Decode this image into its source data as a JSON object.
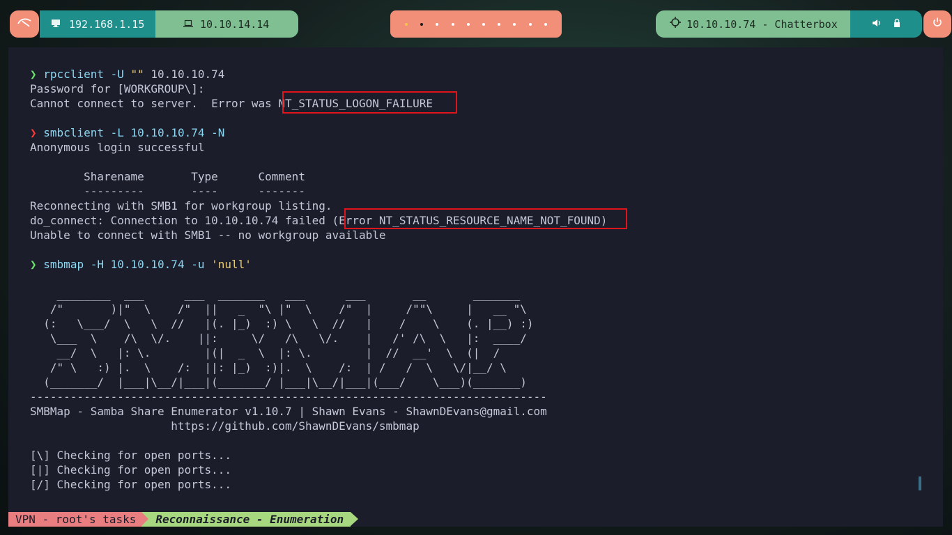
{
  "topbar": {
    "local_ip": "192.168.1.15",
    "vpn_ip": "10.10.14.14",
    "target": "10.10.10.74 - Chatterbox",
    "workspace_count": 10,
    "icons": {
      "logo": "kali-dragon-icon",
      "local": "monitor-icon",
      "vpn": "laptop-icon",
      "target": "crosshair-icon",
      "volume": "volume-icon",
      "lock": "lock-icon",
      "power": "power-icon"
    },
    "colors": {
      "coral": "#f28f79",
      "teal": "#1f8f8c",
      "green": "#7fbf92"
    }
  },
  "terminal": {
    "lines": {
      "l1_cmd": "rpcclient",
      "l1_args": " -U ",
      "l1_str": "\"\"",
      "l1_rest": " 10.10.10.74",
      "l2": "Password for [WORKGROUP\\]:",
      "l3a": "Cannot connect to server.  Error was ",
      "l3b": "NT_STATUS_LOGON_FAILURE",
      "l5_cmd": "smbclient",
      "l5_rest": " -L 10.10.10.74 -N",
      "l6": "Anonymous login successful",
      "l8": "        Sharename       Type      Comment",
      "l9": "        ---------       ----      -------",
      "l10": "Reconnecting with SMB1 for workgroup listing.",
      "l11a": "do_connect: Connection to 10.10.10.74 failed ",
      "l11b": "(Error NT_STATUS_RESOURCE_NAME_NOT_FOUND)",
      "l12": "Unable to connect with SMB1 -- no workgroup available",
      "l14_cmd": "smbmap",
      "l14_args": " -H 10.10.10.74 -u ",
      "l14_str": "'null'",
      "art1": "    ________  ___      ___  _______   ___      ___       __       _______",
      "art2": "   /\"       )|\"  \\    /\"  ||   _  \"\\ |\"  \\    /\"  |     /\"\"\\     |   __ \"\\",
      "art3": "  (:   \\___/  \\   \\  //   |(. |_)  :) \\   \\  //   |    /    \\    (. |__) :)",
      "art4": "   \\___  \\    /\\  \\/.    ||:     \\/   /\\   \\/.    |   /' /\\  \\   |:  ____/",
      "art5": "    __/  \\   |: \\.        |(|  _  \\  |: \\.        |  //  __'  \\  (|  /",
      "art6": "   /\" \\   :) |.  \\    /:  ||: |_)  :)|.  \\    /:  | /   /  \\   \\/|__/ \\",
      "art7": "  (_______/  |___|\\__/|___|(_______/ |___|\\__/|___|(___/    \\___)(_______)",
      "rule": "-----------------------------------------------------------------------------",
      "banner1": "SMBMap - Samba Share Enumerator v1.10.7 | Shawn Evans - ShawnDEvans@gmail.com",
      "banner2": "                     https://github.com/ShawnDEvans/smbmap",
      "p1": "[\\] Checking for open ports...",
      "p2": "[|] Checking for open ports...",
      "p3": "[/] Checking for open ports..."
    },
    "prompt_ok": "❯",
    "prompt_err": "❯"
  },
  "statusbar": {
    "session": "VPN - root's tasks",
    "window": "Reconnaissance - Enumeration"
  }
}
